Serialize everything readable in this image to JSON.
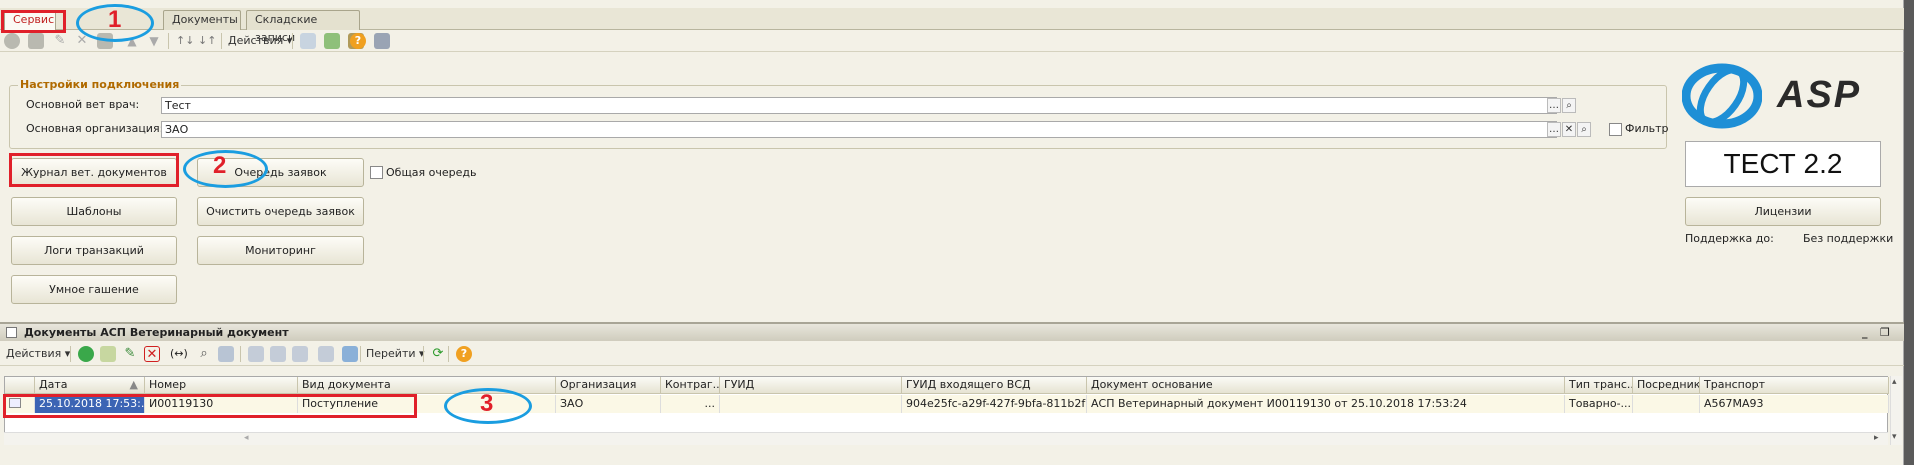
{
  "tabs": [
    {
      "label": "Сервис",
      "active": true
    },
    {
      "label": "Документы",
      "active": false
    },
    {
      "label": "Складские записи",
      "active": false
    }
  ],
  "annotations": {
    "n1": "1",
    "n2": "2",
    "n3": "3"
  },
  "toolbar": {
    "actions_label": "Действия"
  },
  "connection": {
    "legend": "Настройки подключения",
    "vet_label": "Основной вет врач:",
    "vet_value": "Тест",
    "org_label": "Основная организация:",
    "org_value": "ЗАО",
    "filter_label": "Фильтр"
  },
  "buttons": {
    "journal": "Журнал вет. документов",
    "queue": "Очередь заявок",
    "common_queue": "Общая очередь",
    "templates": "Шаблоны",
    "clear_queue": "Очистить очередь заявок",
    "logs": "Логи транзакций",
    "monitoring": "Мониторинг",
    "smart": "Умное гашение",
    "licenses": "Лицензии"
  },
  "brand": {
    "name": "ASP",
    "version": "ТЕСТ 2.2",
    "support_label": "Поддержка до:",
    "support_value": "Без поддержки"
  },
  "panel": {
    "title": "Документы АСП Ветеринарный документ",
    "actions_label": "Действия",
    "goto_label": "Перейти"
  },
  "table": {
    "columns": [
      "Дата",
      "Номер",
      "Вид документа",
      "Организация",
      "Контраг...",
      "ГУИД",
      "ГУИД входящего ВСД",
      "Документ основание",
      "Тип транс...",
      "Посредник",
      "Транспорт"
    ],
    "rows": [
      [
        "25.10.2018 17:53:...",
        "И00119130",
        "Поступление",
        "ЗАО",
        "...",
        "",
        "904e25fc-a29f-427f-9bfa-811b2f9f...",
        "АСП Ветеринарный документ И00119130 от 25.10.2018 17:53:24",
        "Товарно-...",
        "",
        "А567МА93"
      ]
    ]
  },
  "colors": {
    "accent_red": "#e0202a",
    "oval_blue": "#1a9de0",
    "legend_orange": "#b06a00",
    "selection": "#3c64b4"
  }
}
